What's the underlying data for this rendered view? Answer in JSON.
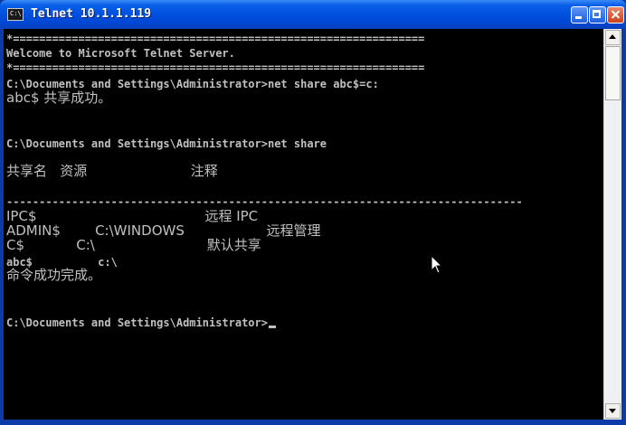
{
  "window": {
    "title": "Telnet 10.1.1.119",
    "icon": "console-icon",
    "icon_text": "C:\\"
  },
  "console": {
    "lines": [
      "*===============================================================",
      "Welcome to Microsoft Telnet Server.",
      "*===============================================================",
      "C:\\Documents and Settings\\Administrator>net share abc$=c:",
      "abc$ 共享成功。",
      "",
      "",
      "C:\\Documents and Settings\\Administrator>net share",
      "",
      "共享名   资源                        注释",
      "",
      "-------------------------------------------------------------------------------",
      "IPC$                                       远程 IPC",
      "ADMIN$        C:\\WINDOWS                   远程管理",
      "C$            C:\\                          默认共享",
      "abc$          c:\\",
      "命令成功完成。",
      "",
      "",
      "C:\\Documents and Settings\\Administrator>"
    ]
  },
  "colors": {
    "console_bg": "#000000",
    "console_text": "#c0c0c0",
    "titlebar": "#0050e0"
  }
}
